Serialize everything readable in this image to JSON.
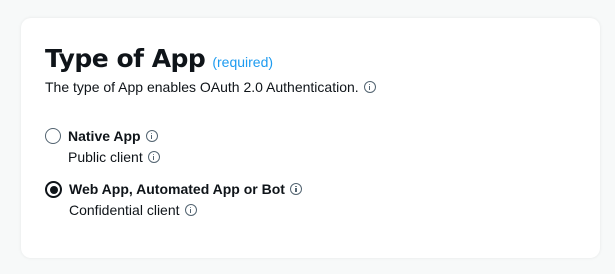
{
  "section": {
    "title": "Type of App",
    "required_label": "(required)",
    "description": "The type of App enables OAuth 2.0 Authentication."
  },
  "options": [
    {
      "label": "Native App",
      "sublabel": "Public client",
      "selected": false
    },
    {
      "label": "Web App, Automated App or Bot",
      "sublabel": "Confidential client",
      "selected": true
    }
  ],
  "colors": {
    "accent": "#1d9bf0",
    "text": "#0f1419",
    "background": "#f7f9f9",
    "card": "#ffffff"
  }
}
